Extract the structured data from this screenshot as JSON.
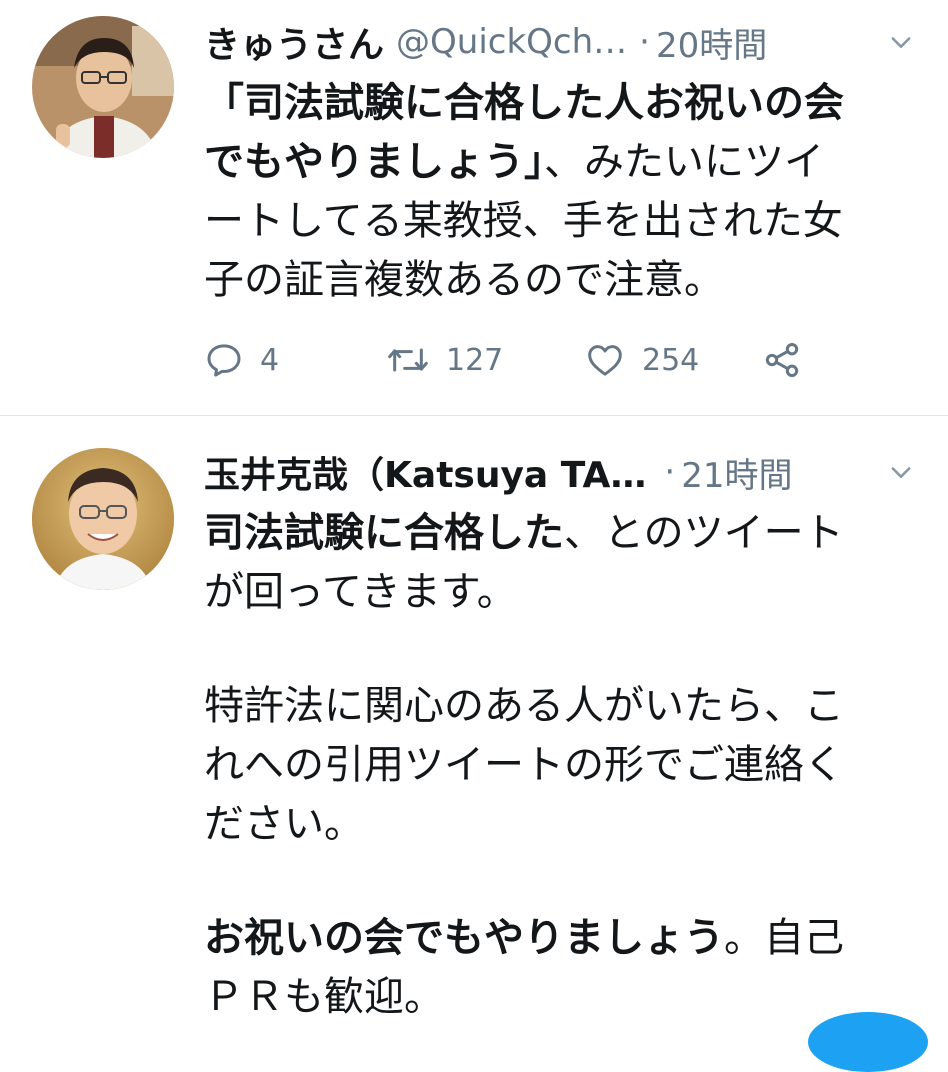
{
  "tweets": [
    {
      "name": "きゅうさん",
      "handle": "@QuickQch…",
      "separator": "·",
      "time": "20時間",
      "avatar_icon": "user-avatar-glasses",
      "text_lines": [
        {
          "text": "「司法試験に合格した人お祝いの会",
          "bold": true
        },
        {
          "text": "でもやりましょう」",
          "bold": true,
          "rest": "、みたいにツイ"
        },
        {
          "text": "ートしてる某教授、手を出された女",
          "bold": false
        },
        {
          "text": "子の証言複数あるので注意。",
          "bold": false
        }
      ],
      "replies": "4",
      "retweets": "127",
      "likes": "254"
    },
    {
      "name": "玉井克哉（Katsuya TA…",
      "separator": "·",
      "time": "21時間",
      "avatar_icon": "user-avatar-smiling",
      "text_lines": [
        {
          "text": "司法試験に合格した",
          "bold": true,
          "rest": "、とのツイート"
        },
        {
          "text": "が回ってきます。",
          "bold": false
        },
        {
          "text": "",
          "blank": true
        },
        {
          "text": "特許法に関心のある人がいたら、こ",
          "bold": false
        },
        {
          "text": "れへの引用ツイートの形でご連絡く",
          "bold": false
        },
        {
          "text": "ださい。",
          "bold": false
        },
        {
          "text": "",
          "blank": true
        },
        {
          "text": "お祝いの会でもやりましょう",
          "bold": true,
          "rest": "。自己"
        },
        {
          "text": "ＰＲも歓迎。",
          "bold": false
        }
      ]
    }
  ],
  "colors": {
    "text": "#14171a",
    "secondary": "#657786",
    "divider": "#e1e8ed",
    "accent": "#1da1f2"
  }
}
